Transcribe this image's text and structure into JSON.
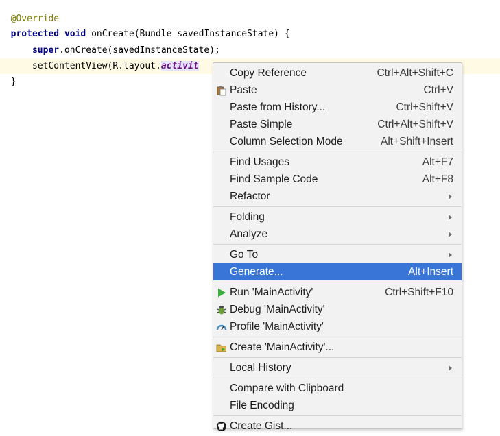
{
  "editor": {
    "lines": [
      {
        "annotation": "@Override"
      },
      {
        "kw1": "protected",
        "kw2": "void",
        "method": "onCreate(Bundle savedInstanceState) {"
      },
      {
        "kw": "super",
        "rest": ".onCreate(savedInstanceState);"
      },
      {
        "call": "setContentView(R.layout.",
        "field": "activit"
      },
      {
        "brace": "}"
      }
    ]
  },
  "menu": {
    "groups": [
      [
        {
          "label": "Copy Reference",
          "shortcut": "Ctrl+Alt+Shift+C"
        },
        {
          "label": "Paste",
          "shortcut": "Ctrl+V",
          "icon": "paste-icon"
        },
        {
          "label": "Paste from History...",
          "shortcut": "Ctrl+Shift+V"
        },
        {
          "label": "Paste Simple",
          "shortcut": "Ctrl+Alt+Shift+V"
        },
        {
          "label": "Column Selection Mode",
          "shortcut": "Alt+Shift+Insert"
        }
      ],
      [
        {
          "label": "Find Usages",
          "shortcut": "Alt+F7"
        },
        {
          "label": "Find Sample Code",
          "shortcut": "Alt+F8"
        },
        {
          "label": "Refactor",
          "submenu": true
        }
      ],
      [
        {
          "label": "Folding",
          "submenu": true
        },
        {
          "label": "Analyze",
          "submenu": true
        }
      ],
      [
        {
          "label": "Go To",
          "submenu": true
        },
        {
          "label": "Generate...",
          "shortcut": "Alt+Insert",
          "highlighted": true
        }
      ],
      [
        {
          "label": "Run 'MainActivity'",
          "shortcut": "Ctrl+Shift+F10",
          "icon": "run-icon"
        },
        {
          "label": "Debug 'MainActivity'",
          "icon": "debug-icon"
        },
        {
          "label": "Profile 'MainActivity'",
          "icon": "profile-icon"
        }
      ],
      [
        {
          "label": "Create 'MainActivity'...",
          "icon": "create-config-icon"
        }
      ],
      [
        {
          "label": "Local History",
          "submenu": true
        }
      ],
      [
        {
          "label": "Compare with Clipboard"
        },
        {
          "label": "File Encoding"
        }
      ],
      [
        {
          "label": "Create Gist...",
          "icon": "github-icon"
        }
      ]
    ]
  },
  "colors": {
    "highlight": "#3875d7",
    "run_green": "#3cae3f",
    "keyword": "#000080",
    "annotation": "#808000"
  }
}
